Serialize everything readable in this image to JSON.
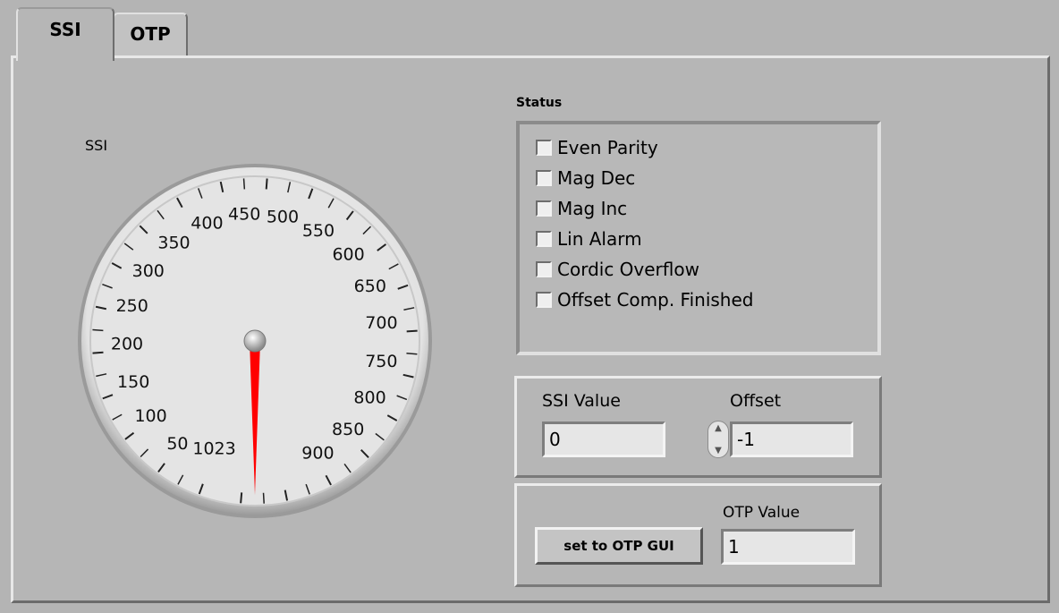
{
  "tabs": [
    {
      "label": "SSI",
      "selected": true
    },
    {
      "label": "OTP",
      "selected": false
    }
  ],
  "gauge": {
    "label": "SSI",
    "min": 0,
    "max": 1023,
    "needle_value": 0,
    "needle_color": "#ff0000",
    "tick_labels": [
      "50",
      "100",
      "150",
      "200",
      "250",
      "300",
      "350",
      "400",
      "450",
      "500",
      "550",
      "600",
      "650",
      "700",
      "750",
      "800",
      "850",
      "900",
      "1023"
    ]
  },
  "status": {
    "label": "Status",
    "items": [
      {
        "label": "Even Parity",
        "checked": false
      },
      {
        "label": "Mag Dec",
        "checked": false
      },
      {
        "label": "Mag Inc",
        "checked": false
      },
      {
        "label": "Lin Alarm",
        "checked": false
      },
      {
        "label": "Cordic Overflow",
        "checked": false
      },
      {
        "label": "Offset Comp. Finished",
        "checked": false
      }
    ]
  },
  "ssi_value": {
    "label": "SSI Value",
    "value": "0"
  },
  "offset": {
    "label": "Offset",
    "value": "-1"
  },
  "otp_value": {
    "label": "OTP Value",
    "value": "1"
  },
  "otp_button": {
    "label": "set  to OTP GUI"
  },
  "colors": {
    "panel": "#b6b6b6",
    "field": "#e6e6e6",
    "needle": "#ff0000"
  }
}
